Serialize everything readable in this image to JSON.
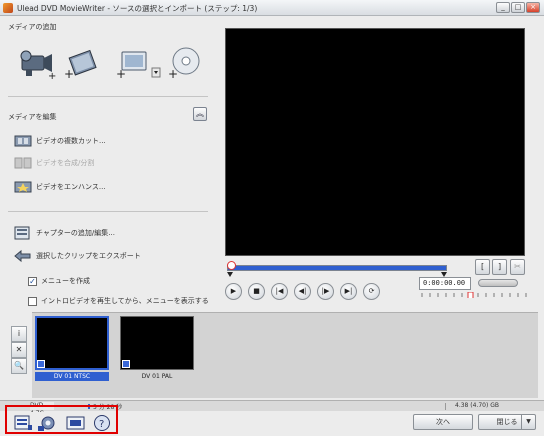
{
  "window": {
    "title": "Ulead DVD MovieWriter - ソースの選択とインポート (ステップ: 1/3)",
    "buttons": {
      "minimize": "_",
      "maximize": "□",
      "close": "×"
    }
  },
  "media_add": {
    "label": "メディアの追加",
    "icons": [
      "camcorder-icon",
      "film-add-icon",
      "photo-add-icon",
      "disc-add-icon"
    ]
  },
  "media_edit": {
    "label": "メディアを編集",
    "actions": [
      {
        "label": "ビデオの複数カット...",
        "enabled": true
      },
      {
        "label": "ビデオを合成/分割",
        "enabled": false
      },
      {
        "label": "ビデオをエンハンス...",
        "enabled": true
      }
    ]
  },
  "chapter": {
    "add_edit": "チャプターの追加/編集...",
    "export": "選択したクリップをエクスポート"
  },
  "options": {
    "create_menu": {
      "label": "メニューを作成",
      "checked": true
    },
    "intro_menu": {
      "label": "イントロビデオを再生してから、メニューを表示する",
      "checked": false
    }
  },
  "preview": {
    "timecode": "0:00:00.00",
    "mark_in": "[",
    "mark_out": "]",
    "cut": "✂",
    "transport": [
      "▶",
      "■",
      "|◀",
      "◀|",
      "|▶",
      "▶|",
      "⟳"
    ],
    "progress": 1.0
  },
  "bin": {
    "tools": [
      "i",
      "✕",
      "🔍"
    ],
    "clips": [
      {
        "label": "DV 01 NTSC",
        "selected": true
      },
      {
        "label": "DV 01 PAL",
        "selected": false
      }
    ]
  },
  "status": {
    "capacity": "DVD 4.7G",
    "elapsed": "5 分 28 秒",
    "right_text": "4.38 (4.70) GB"
  },
  "footer": {
    "next_label": "次へ",
    "close_label": "閉じる",
    "icons": [
      "project-settings-icon",
      "preferences-icon",
      "video-settings-icon",
      "help-icon"
    ]
  },
  "colors": {
    "accent": "#2f5fd0",
    "highlight": "#e00000"
  }
}
